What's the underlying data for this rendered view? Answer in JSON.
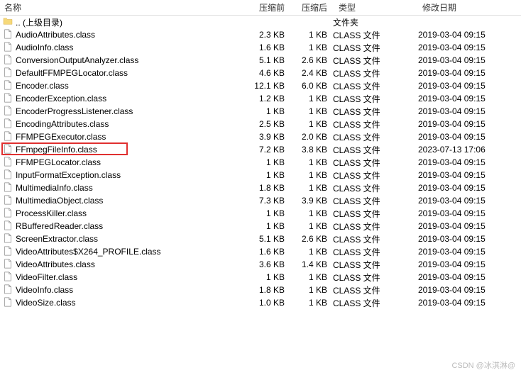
{
  "header": {
    "name": "名称",
    "before": "压缩前",
    "after": "压缩后",
    "type": "类型",
    "date": "修改日期"
  },
  "rows": [
    {
      "name": ".. (上级目录)",
      "before": "",
      "after": "",
      "type": "文件夹",
      "date": "",
      "kind": "folder"
    },
    {
      "name": "AudioAttributes.class",
      "before": "2.3 KB",
      "after": "1 KB",
      "type": "CLASS 文件",
      "date": "2019-03-04 09:15",
      "kind": "file"
    },
    {
      "name": "AudioInfo.class",
      "before": "1.6 KB",
      "after": "1 KB",
      "type": "CLASS 文件",
      "date": "2019-03-04 09:15",
      "kind": "file"
    },
    {
      "name": "ConversionOutputAnalyzer.class",
      "before": "5.1 KB",
      "after": "2.6 KB",
      "type": "CLASS 文件",
      "date": "2019-03-04 09:15",
      "kind": "file"
    },
    {
      "name": "DefaultFFMPEGLocator.class",
      "before": "4.6 KB",
      "after": "2.4 KB",
      "type": "CLASS 文件",
      "date": "2019-03-04 09:15",
      "kind": "file"
    },
    {
      "name": "Encoder.class",
      "before": "12.1 KB",
      "after": "6.0 KB",
      "type": "CLASS 文件",
      "date": "2019-03-04 09:15",
      "kind": "file"
    },
    {
      "name": "EncoderException.class",
      "before": "1.2 KB",
      "after": "1 KB",
      "type": "CLASS 文件",
      "date": "2019-03-04 09:15",
      "kind": "file"
    },
    {
      "name": "EncoderProgressListener.class",
      "before": "1 KB",
      "after": "1 KB",
      "type": "CLASS 文件",
      "date": "2019-03-04 09:15",
      "kind": "file"
    },
    {
      "name": "EncodingAttributes.class",
      "before": "2.5 KB",
      "after": "1 KB",
      "type": "CLASS 文件",
      "date": "2019-03-04 09:15",
      "kind": "file"
    },
    {
      "name": "FFMPEGExecutor.class",
      "before": "3.9 KB",
      "after": "2.0 KB",
      "type": "CLASS 文件",
      "date": "2019-03-04 09:15",
      "kind": "file"
    },
    {
      "name": "FFmpegFileInfo.class",
      "before": "7.2 KB",
      "after": "3.8 KB",
      "type": "CLASS 文件",
      "date": "2023-07-13 17:06",
      "kind": "file",
      "highlighted": true
    },
    {
      "name": "FFMPEGLocator.class",
      "before": "1 KB",
      "after": "1 KB",
      "type": "CLASS 文件",
      "date": "2019-03-04 09:15",
      "kind": "file"
    },
    {
      "name": "InputFormatException.class",
      "before": "1 KB",
      "after": "1 KB",
      "type": "CLASS 文件",
      "date": "2019-03-04 09:15",
      "kind": "file"
    },
    {
      "name": "MultimediaInfo.class",
      "before": "1.8 KB",
      "after": "1 KB",
      "type": "CLASS 文件",
      "date": "2019-03-04 09:15",
      "kind": "file"
    },
    {
      "name": "MultimediaObject.class",
      "before": "7.3 KB",
      "after": "3.9 KB",
      "type": "CLASS 文件",
      "date": "2019-03-04 09:15",
      "kind": "file"
    },
    {
      "name": "ProcessKiller.class",
      "before": "1 KB",
      "after": "1 KB",
      "type": "CLASS 文件",
      "date": "2019-03-04 09:15",
      "kind": "file"
    },
    {
      "name": "RBufferedReader.class",
      "before": "1 KB",
      "after": "1 KB",
      "type": "CLASS 文件",
      "date": "2019-03-04 09:15",
      "kind": "file"
    },
    {
      "name": "ScreenExtractor.class",
      "before": "5.1 KB",
      "after": "2.6 KB",
      "type": "CLASS 文件",
      "date": "2019-03-04 09:15",
      "kind": "file"
    },
    {
      "name": "VideoAttributes$X264_PROFILE.class",
      "before": "1.6 KB",
      "after": "1 KB",
      "type": "CLASS 文件",
      "date": "2019-03-04 09:15",
      "kind": "file"
    },
    {
      "name": "VideoAttributes.class",
      "before": "3.6 KB",
      "after": "1.4 KB",
      "type": "CLASS 文件",
      "date": "2019-03-04 09:15",
      "kind": "file"
    },
    {
      "name": "VideoFilter.class",
      "before": "1 KB",
      "after": "1 KB",
      "type": "CLASS 文件",
      "date": "2019-03-04 09:15",
      "kind": "file"
    },
    {
      "name": "VideoInfo.class",
      "before": "1.8 KB",
      "after": "1 KB",
      "type": "CLASS 文件",
      "date": "2019-03-04 09:15",
      "kind": "file"
    },
    {
      "name": "VideoSize.class",
      "before": "1.0 KB",
      "after": "1 KB",
      "type": "CLASS 文件",
      "date": "2019-03-04 09:15",
      "kind": "file"
    }
  ],
  "watermark": "CSDN @冰淇淋@"
}
